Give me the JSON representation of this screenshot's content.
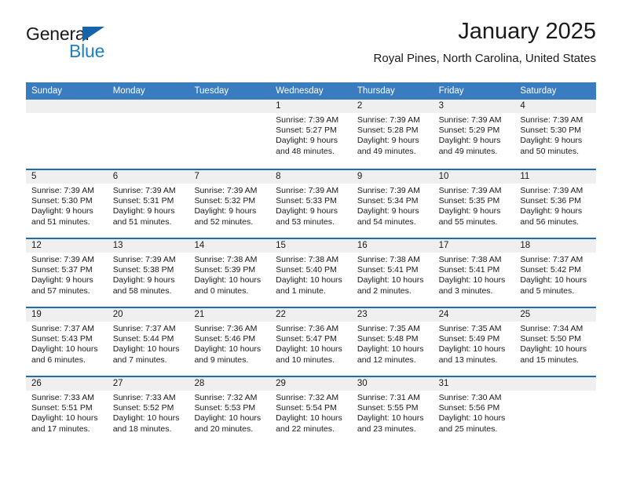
{
  "brand": {
    "name_part1": "General",
    "name_part2": "Blue",
    "triangle_color": "#1565aa",
    "blue_text_color": "#1f7ec4"
  },
  "header": {
    "month_title": "January 2025",
    "location": "Royal Pines, North Carolina, United States"
  },
  "theme": {
    "header_blue": "#3a7cc0",
    "row_divider_blue": "#1f6cb0",
    "date_band_gray": "#efefef"
  },
  "weekdays": [
    "Sunday",
    "Monday",
    "Tuesday",
    "Wednesday",
    "Thursday",
    "Friday",
    "Saturday"
  ],
  "weeks": [
    [
      {
        "day": "",
        "empty": true,
        "sunrise": "",
        "sunset": "",
        "daylight1": "",
        "daylight2": ""
      },
      {
        "day": "",
        "empty": true,
        "sunrise": "",
        "sunset": "",
        "daylight1": "",
        "daylight2": ""
      },
      {
        "day": "",
        "empty": true,
        "sunrise": "",
        "sunset": "",
        "daylight1": "",
        "daylight2": ""
      },
      {
        "day": "1",
        "sunrise": "Sunrise: 7:39 AM",
        "sunset": "Sunset: 5:27 PM",
        "daylight1": "Daylight: 9 hours",
        "daylight2": "and 48 minutes."
      },
      {
        "day": "2",
        "sunrise": "Sunrise: 7:39 AM",
        "sunset": "Sunset: 5:28 PM",
        "daylight1": "Daylight: 9 hours",
        "daylight2": "and 49 minutes."
      },
      {
        "day": "3",
        "sunrise": "Sunrise: 7:39 AM",
        "sunset": "Sunset: 5:29 PM",
        "daylight1": "Daylight: 9 hours",
        "daylight2": "and 49 minutes."
      },
      {
        "day": "4",
        "sunrise": "Sunrise: 7:39 AM",
        "sunset": "Sunset: 5:30 PM",
        "daylight1": "Daylight: 9 hours",
        "daylight2": "and 50 minutes."
      }
    ],
    [
      {
        "day": "5",
        "sunrise": "Sunrise: 7:39 AM",
        "sunset": "Sunset: 5:30 PM",
        "daylight1": "Daylight: 9 hours",
        "daylight2": "and 51 minutes."
      },
      {
        "day": "6",
        "sunrise": "Sunrise: 7:39 AM",
        "sunset": "Sunset: 5:31 PM",
        "daylight1": "Daylight: 9 hours",
        "daylight2": "and 51 minutes."
      },
      {
        "day": "7",
        "sunrise": "Sunrise: 7:39 AM",
        "sunset": "Sunset: 5:32 PM",
        "daylight1": "Daylight: 9 hours",
        "daylight2": "and 52 minutes."
      },
      {
        "day": "8",
        "sunrise": "Sunrise: 7:39 AM",
        "sunset": "Sunset: 5:33 PM",
        "daylight1": "Daylight: 9 hours",
        "daylight2": "and 53 minutes."
      },
      {
        "day": "9",
        "sunrise": "Sunrise: 7:39 AM",
        "sunset": "Sunset: 5:34 PM",
        "daylight1": "Daylight: 9 hours",
        "daylight2": "and 54 minutes."
      },
      {
        "day": "10",
        "sunrise": "Sunrise: 7:39 AM",
        "sunset": "Sunset: 5:35 PM",
        "daylight1": "Daylight: 9 hours",
        "daylight2": "and 55 minutes."
      },
      {
        "day": "11",
        "sunrise": "Sunrise: 7:39 AM",
        "sunset": "Sunset: 5:36 PM",
        "daylight1": "Daylight: 9 hours",
        "daylight2": "and 56 minutes."
      }
    ],
    [
      {
        "day": "12",
        "sunrise": "Sunrise: 7:39 AM",
        "sunset": "Sunset: 5:37 PM",
        "daylight1": "Daylight: 9 hours",
        "daylight2": "and 57 minutes."
      },
      {
        "day": "13",
        "sunrise": "Sunrise: 7:39 AM",
        "sunset": "Sunset: 5:38 PM",
        "daylight1": "Daylight: 9 hours",
        "daylight2": "and 58 minutes."
      },
      {
        "day": "14",
        "sunrise": "Sunrise: 7:38 AM",
        "sunset": "Sunset: 5:39 PM",
        "daylight1": "Daylight: 10 hours",
        "daylight2": "and 0 minutes."
      },
      {
        "day": "15",
        "sunrise": "Sunrise: 7:38 AM",
        "sunset": "Sunset: 5:40 PM",
        "daylight1": "Daylight: 10 hours",
        "daylight2": "and 1 minute."
      },
      {
        "day": "16",
        "sunrise": "Sunrise: 7:38 AM",
        "sunset": "Sunset: 5:41 PM",
        "daylight1": "Daylight: 10 hours",
        "daylight2": "and 2 minutes."
      },
      {
        "day": "17",
        "sunrise": "Sunrise: 7:38 AM",
        "sunset": "Sunset: 5:41 PM",
        "daylight1": "Daylight: 10 hours",
        "daylight2": "and 3 minutes."
      },
      {
        "day": "18",
        "sunrise": "Sunrise: 7:37 AM",
        "sunset": "Sunset: 5:42 PM",
        "daylight1": "Daylight: 10 hours",
        "daylight2": "and 5 minutes."
      }
    ],
    [
      {
        "day": "19",
        "sunrise": "Sunrise: 7:37 AM",
        "sunset": "Sunset: 5:43 PM",
        "daylight1": "Daylight: 10 hours",
        "daylight2": "and 6 minutes."
      },
      {
        "day": "20",
        "sunrise": "Sunrise: 7:37 AM",
        "sunset": "Sunset: 5:44 PM",
        "daylight1": "Daylight: 10 hours",
        "daylight2": "and 7 minutes."
      },
      {
        "day": "21",
        "sunrise": "Sunrise: 7:36 AM",
        "sunset": "Sunset: 5:46 PM",
        "daylight1": "Daylight: 10 hours",
        "daylight2": "and 9 minutes."
      },
      {
        "day": "22",
        "sunrise": "Sunrise: 7:36 AM",
        "sunset": "Sunset: 5:47 PM",
        "daylight1": "Daylight: 10 hours",
        "daylight2": "and 10 minutes."
      },
      {
        "day": "23",
        "sunrise": "Sunrise: 7:35 AM",
        "sunset": "Sunset: 5:48 PM",
        "daylight1": "Daylight: 10 hours",
        "daylight2": "and 12 minutes."
      },
      {
        "day": "24",
        "sunrise": "Sunrise: 7:35 AM",
        "sunset": "Sunset: 5:49 PM",
        "daylight1": "Daylight: 10 hours",
        "daylight2": "and 13 minutes."
      },
      {
        "day": "25",
        "sunrise": "Sunrise: 7:34 AM",
        "sunset": "Sunset: 5:50 PM",
        "daylight1": "Daylight: 10 hours",
        "daylight2": "and 15 minutes."
      }
    ],
    [
      {
        "day": "26",
        "sunrise": "Sunrise: 7:33 AM",
        "sunset": "Sunset: 5:51 PM",
        "daylight1": "Daylight: 10 hours",
        "daylight2": "and 17 minutes."
      },
      {
        "day": "27",
        "sunrise": "Sunrise: 7:33 AM",
        "sunset": "Sunset: 5:52 PM",
        "daylight1": "Daylight: 10 hours",
        "daylight2": "and 18 minutes."
      },
      {
        "day": "28",
        "sunrise": "Sunrise: 7:32 AM",
        "sunset": "Sunset: 5:53 PM",
        "daylight1": "Daylight: 10 hours",
        "daylight2": "and 20 minutes."
      },
      {
        "day": "29",
        "sunrise": "Sunrise: 7:32 AM",
        "sunset": "Sunset: 5:54 PM",
        "daylight1": "Daylight: 10 hours",
        "daylight2": "and 22 minutes."
      },
      {
        "day": "30",
        "sunrise": "Sunrise: 7:31 AM",
        "sunset": "Sunset: 5:55 PM",
        "daylight1": "Daylight: 10 hours",
        "daylight2": "and 23 minutes."
      },
      {
        "day": "31",
        "sunrise": "Sunrise: 7:30 AM",
        "sunset": "Sunset: 5:56 PM",
        "daylight1": "Daylight: 10 hours",
        "daylight2": "and 25 minutes."
      },
      {
        "day": "",
        "empty": true,
        "sunrise": "",
        "sunset": "",
        "daylight1": "",
        "daylight2": ""
      }
    ]
  ]
}
